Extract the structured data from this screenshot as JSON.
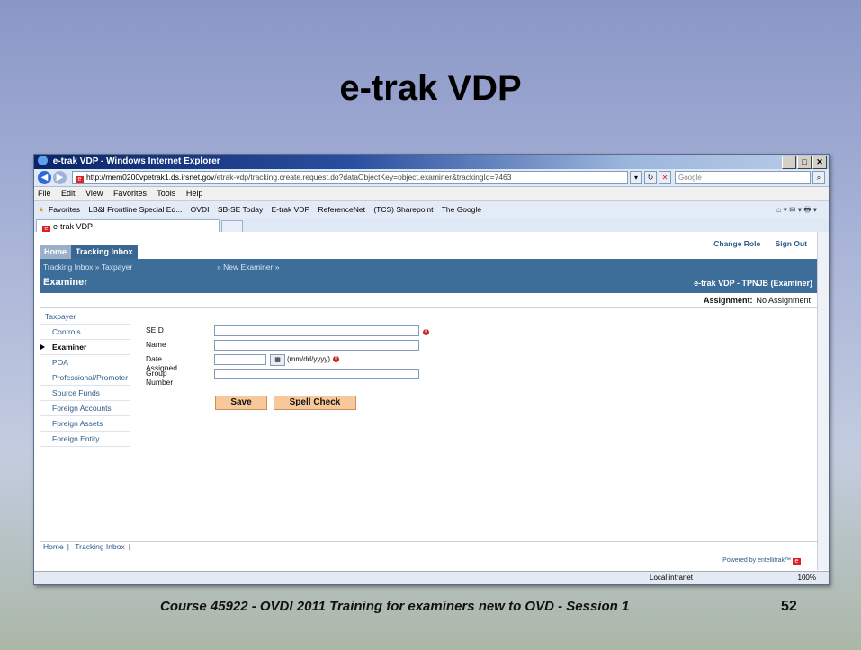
{
  "slide": {
    "title": "e-trak VDP",
    "footer": "Course 45922 - OVDI 2011 Training for examiners new to OVD - Session 1",
    "page_number": "52"
  },
  "browser": {
    "window_title": "e-trak VDP - Windows Internet Explorer",
    "address_host": "http://mem0200vpetrak1.ds.irsnet.gov",
    "address_path": "/etrak-vdp/tracking.create.request.do?dataObjectKey=object.examiner&trackingId=7463",
    "search_placeholder": "Google",
    "menu": [
      "File",
      "Edit",
      "View",
      "Favorites",
      "Tools",
      "Help"
    ],
    "favorites": [
      "Favorites",
      "LB&I Frontline Special Ed...",
      "OVDI",
      "SB-SE Today",
      "E-trak VDP",
      "ReferenceNet",
      "(TCS) Sharepoint",
      "The Google"
    ],
    "tab_label": "e-trak VDP",
    "status_zone": "Local intranet",
    "zoom": "100%"
  },
  "app": {
    "tabs": [
      "Home",
      "Tracking Inbox"
    ],
    "top_links": [
      "Change Role",
      "Sign Out"
    ],
    "breadcrumb": "Tracking Inbox » Taxpayer",
    "breadcrumb_next": "» New Examiner »",
    "page_title": "Examiner",
    "role": "e-trak VDP - TPNJB (Examiner)",
    "assignment_label": "Assignment:",
    "assignment_value": "No Assignment",
    "sidebar": [
      "Taxpayer",
      "Controls",
      "Examiner",
      "POA",
      "Professional/Promoter",
      "Source Funds",
      "Foreign Accounts",
      "Foreign Assets",
      "Foreign Entity"
    ],
    "form": {
      "seid_label": "SEID",
      "name_label": "Name",
      "date_label": "Date Assigned",
      "date_format": "(mm/dd/yyyy)",
      "group_label": "Group Number"
    },
    "buttons": {
      "save": "Save",
      "spell_check": "Spell Check"
    },
    "footer_links": [
      "Home",
      "Tracking Inbox"
    ],
    "powered_by": "Powered by entellitrak™"
  }
}
